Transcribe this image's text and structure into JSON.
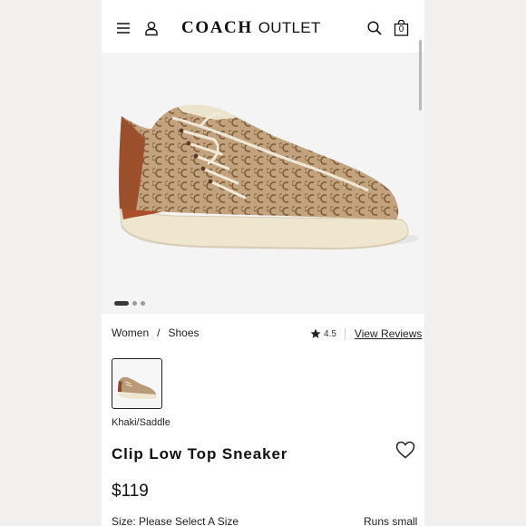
{
  "header": {
    "brand_name": "COACH",
    "brand_sub": "OUTLET",
    "bag_count": "0"
  },
  "gallery": {
    "dots": [
      true,
      false,
      false
    ]
  },
  "breadcrumb": {
    "items": [
      "Women",
      "Shoes"
    ],
    "separator": "/"
  },
  "rating": {
    "value": "4.5",
    "link_label": "View Reviews"
  },
  "product": {
    "color_name": "Khaki/Saddle",
    "title": "Clip Low Top Sneaker",
    "price": "$119",
    "size_label": "Size:",
    "size_value": "Please Select A Size",
    "fit_note": "Runs small"
  },
  "icons": {
    "menu": "hamburger-menu-icon",
    "account": "user-icon",
    "search": "search-icon",
    "bag": "shopping-bag-icon",
    "star": "star-icon",
    "wishlist": "heart-icon"
  },
  "colors": {
    "page_bg": "#f1f0ef",
    "text": "#1a1a1a",
    "shoe_khaki": "#b99a76",
    "shoe_saddle": "#8a4a2b",
    "sole": "#efe6d0"
  }
}
